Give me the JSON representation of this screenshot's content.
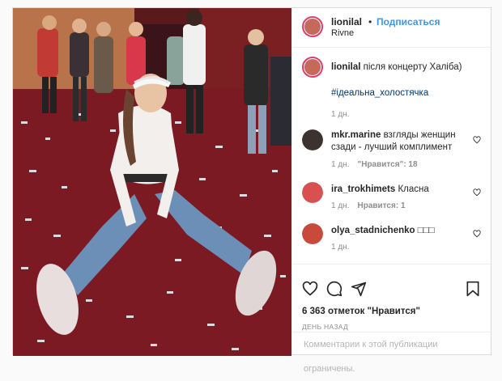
{
  "post": {
    "username": "lionilal",
    "dot": "•",
    "follow_label": "Подписаться",
    "location": "Rivne"
  },
  "caption": {
    "username": "lionilal",
    "text": "після концерту Халіба)",
    "hashtag": "#ідеальна_холостячка",
    "time": "1 дн."
  },
  "comments": [
    {
      "username": "mkr.marine",
      "text": "взгляды женщин сзади - лучший комплимент",
      "time": "1 дн.",
      "likes": "\"Нравится\": 18"
    },
    {
      "username": "ira_trokhimets",
      "text": "Класна",
      "time": "1 дн.",
      "likes": "Нравится: 1"
    },
    {
      "username": "olya_stadnichenko",
      "text": "",
      "time": "1 дн.",
      "likes": ""
    }
  ],
  "footer": {
    "likes_count": "6 363 отметок \"Нравится\"",
    "date_label": "ДЕНЬ НАЗАД",
    "comments_closed": "Комментарии к этой публикации ограничены."
  },
  "icons": {
    "like": "heart-icon",
    "comment": "comment-icon",
    "share": "share-icon",
    "save": "bookmark-icon"
  },
  "colors": {
    "link": "#3897f0",
    "hashtag": "#00376b",
    "muted": "#8e8e8e",
    "story_ring": "#e23b6b"
  }
}
